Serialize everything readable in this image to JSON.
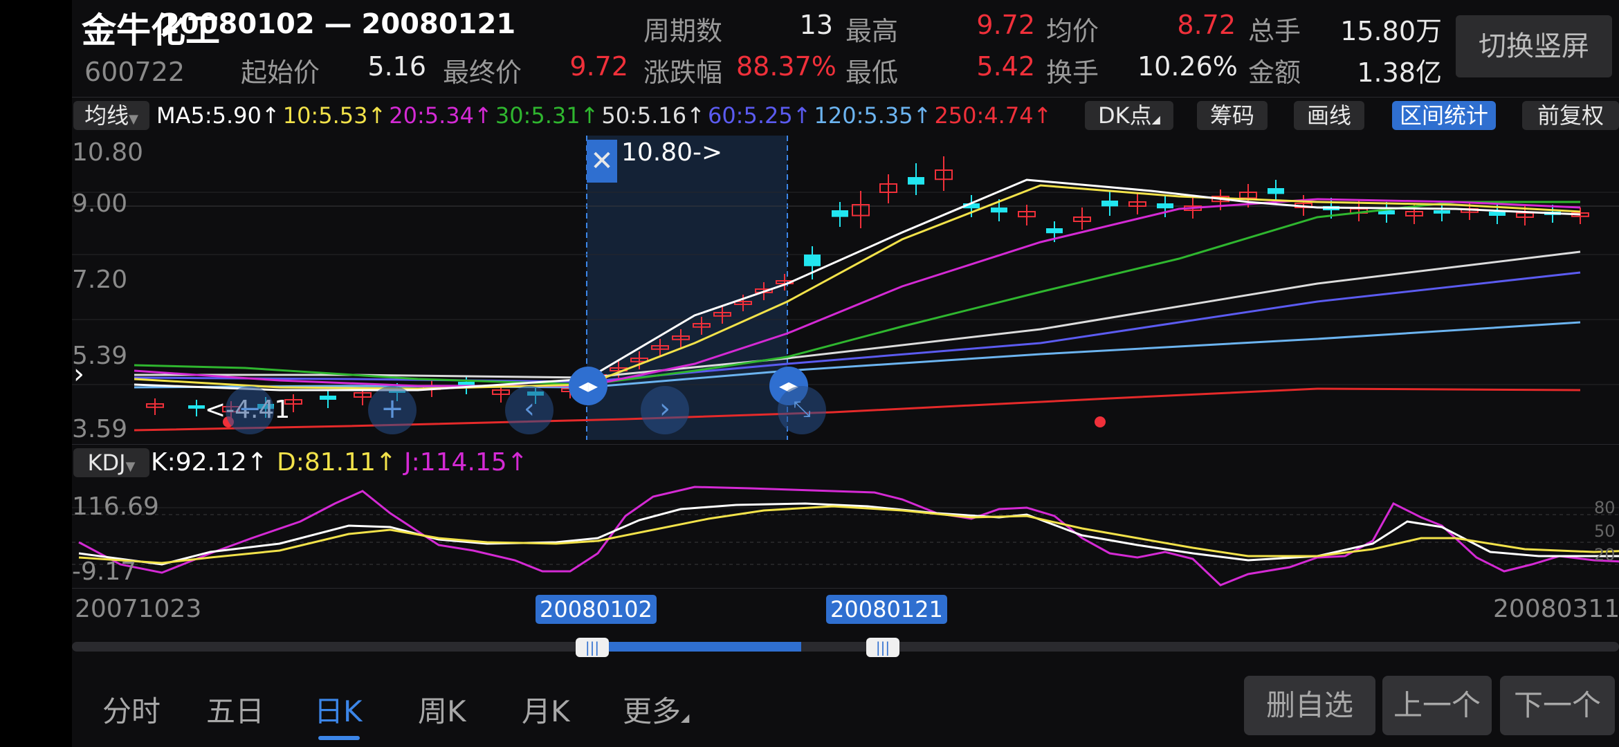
{
  "header": {
    "stock_name": "金牛化工",
    "stock_code": "600722",
    "range": "20080102 — 20080121",
    "labels": {
      "periods": "周期数",
      "high": "最高",
      "avg": "均价",
      "total_volume": "总手",
      "start_price": "起始价",
      "end_price": "最终价",
      "change_pct": "涨跌幅",
      "low": "最低",
      "turnover": "换手",
      "amount": "金额"
    },
    "values": {
      "periods": "13",
      "high": "9.72",
      "avg": "8.72",
      "total_volume": "15.80万",
      "start_price": "5.16",
      "end_price": "9.72",
      "change_pct": "88.37%",
      "low": "5.42",
      "turnover": "10.26%",
      "amount": "1.38亿"
    },
    "switch_button": "切换竖屏"
  },
  "ma_bar": {
    "selector": "均线",
    "items": [
      {
        "text": "MA5:5.90↑",
        "color": "#ffffff"
      },
      {
        "text": "10:5.53↑",
        "color": "#f2e24a"
      },
      {
        "text": "20:5.34↑",
        "color": "#d42ad4"
      },
      {
        "text": "30:5.31↑",
        "color": "#2fb62f"
      },
      {
        "text": "50:5.16↑",
        "color": "#e0e0e0"
      },
      {
        "text": "60:5.25↑",
        "color": "#5b5bf0"
      },
      {
        "text": "120:5.35↑",
        "color": "#6cb4f0"
      },
      {
        "text": "250:4.74↑",
        "color": "#f0303a"
      }
    ],
    "buttons": {
      "dk": "DK点",
      "chips": "筹码",
      "draw": "画线",
      "interval": "区间统计",
      "adjust": "前复权"
    }
  },
  "price_chart": {
    "y_labels": [
      "10.80",
      "9.00",
      "7.20",
      "5.39",
      "3.59"
    ],
    "max_marker": "10.80->",
    "min_marker": "<-4.41"
  },
  "kdj": {
    "selector": "KDJ",
    "k": "K:92.12↑",
    "d": "D:81.11↑",
    "j": "J:114.15↑",
    "y_labels": [
      "116.69",
      "-9.17"
    ],
    "right_labels": [
      "80",
      "50",
      "20"
    ]
  },
  "timeline": {
    "start": "20071023",
    "end": "20080311",
    "sel_start": "20080102",
    "sel_end": "20080121"
  },
  "tabs": [
    "分时",
    "五日",
    "日K",
    "周K",
    "月K",
    "更多"
  ],
  "selected_tab": "日K",
  "actions": {
    "delete": "删自选",
    "prev": "上一个",
    "next": "下一个"
  },
  "colors": {
    "up": "#f0303a",
    "down": "#22e6f0",
    "accent": "#2f6fd0"
  }
}
